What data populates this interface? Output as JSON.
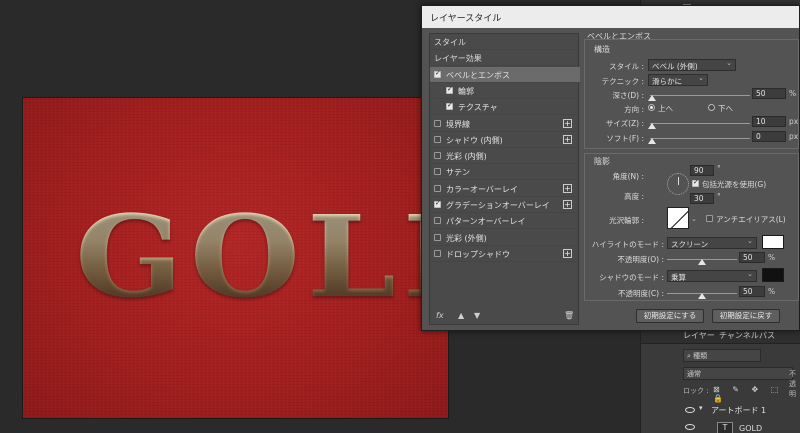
{
  "canvas": {
    "text": "GOLD"
  },
  "dialog": {
    "title": "レイヤースタイル",
    "styles_list": [
      {
        "label": "スタイル",
        "kind": "header"
      },
      {
        "label": "レイヤー効果",
        "kind": "header"
      },
      {
        "label": "ベベルとエンボス",
        "checked": true,
        "active": true
      },
      {
        "label": "輪郭",
        "checked": true,
        "sub": true
      },
      {
        "label": "テクスチャ",
        "checked": true,
        "sub": true
      },
      {
        "label": "境界線",
        "checked": false,
        "plus": true
      },
      {
        "label": "シャドウ (内側)",
        "checked": false,
        "plus": true
      },
      {
        "label": "光彩 (内側)",
        "checked": false
      },
      {
        "label": "サテン",
        "checked": false
      },
      {
        "label": "カラーオーバーレイ",
        "checked": false,
        "plus": true
      },
      {
        "label": "グラデーションオーバーレイ",
        "checked": true,
        "plus": true
      },
      {
        "label": "パターンオーバーレイ",
        "checked": false
      },
      {
        "label": "光彩 (外側)",
        "checked": false
      },
      {
        "label": "ドロップシャドウ",
        "checked": false,
        "plus": true
      }
    ],
    "footer_fx": "fx",
    "bevel": {
      "section_title": "ベベルとエンボス",
      "structure_title": "構造",
      "style_label": "スタイル :",
      "style_value": "ベベル (外側)",
      "technique_label": "テクニック :",
      "technique_value": "滑らかに",
      "depth_label": "深さ(D) :",
      "depth_value": "50",
      "depth_unit": "%",
      "direction_label": "方向 :",
      "direction_up": "上へ",
      "direction_down": "下へ",
      "size_label": "サイズ(Z) :",
      "size_value": "10",
      "size_unit": "px",
      "soften_label": "ソフト(F) :",
      "soften_value": "0",
      "soften_unit": "px",
      "shading_title": "陰影",
      "angle_label": "角度(N) :",
      "angle_value": "90",
      "angle_unit": "°",
      "global_light_label": "包括光源を使用(G)",
      "altitude_label": "高度 :",
      "altitude_value": "30",
      "altitude_unit": "°",
      "gloss_label": "光沢輪郭 :",
      "antialias_label": "アンチエイリアス(L)",
      "highlight_mode_label": "ハイライトのモード :",
      "highlight_mode_value": "スクリーン",
      "highlight_color": "#ffffff",
      "highlight_opacity_label": "不透明度(O) :",
      "highlight_opacity_value": "50",
      "highlight_opacity_unit": "%",
      "shadow_mode_label": "シャドウのモード :",
      "shadow_mode_value": "乗算",
      "shadow_color": "#111111",
      "shadow_opacity_label": "不透明度(C) :",
      "shadow_opacity_value": "50",
      "shadow_opacity_unit": "%",
      "make_default_label": "初期設定にする",
      "reset_default_label": "初期設定に戻す"
    }
  },
  "layers": {
    "tabs": [
      "レイヤー",
      "チャンネル",
      "パス"
    ],
    "search_placeholder": "種類",
    "blend_mode": "通常",
    "opacity_label": "不透明",
    "lock_label": "ロック :",
    "lock_icons": "⊠ ✎ ✥ ⬚ 🔒",
    "artboard_name": "アートボード 1",
    "gold_layer_name": "GOLD",
    "gold_layer_thumb": "T"
  }
}
